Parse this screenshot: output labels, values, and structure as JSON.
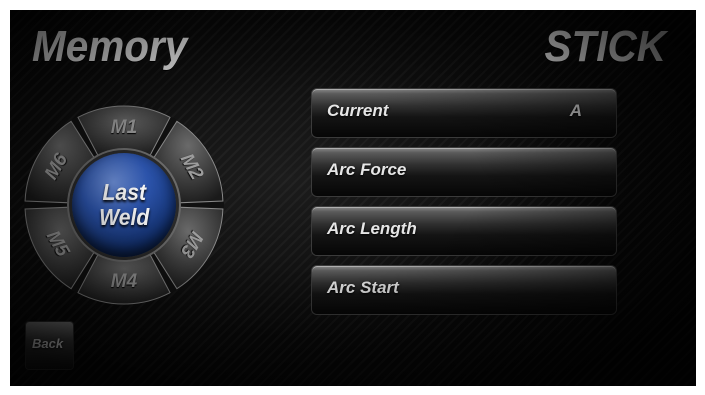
{
  "header": {
    "title": "Memory",
    "mode": "STICK"
  },
  "memory_dial": {
    "slots": [
      "M1",
      "M2",
      "M3",
      "M4",
      "M5",
      "M6"
    ],
    "center_label": "Last\nWeld"
  },
  "parameters": [
    {
      "label": "Current",
      "unit": "A"
    },
    {
      "label": "Arc Force",
      "unit": ""
    },
    {
      "label": "Arc Length",
      "unit": ""
    },
    {
      "label": "Arc Start",
      "unit": ""
    }
  ],
  "footer": {
    "back_label": "Back"
  },
  "colors": {
    "background": "#050505",
    "center_button": "#2d56b0",
    "text": "#f2f2f2"
  }
}
